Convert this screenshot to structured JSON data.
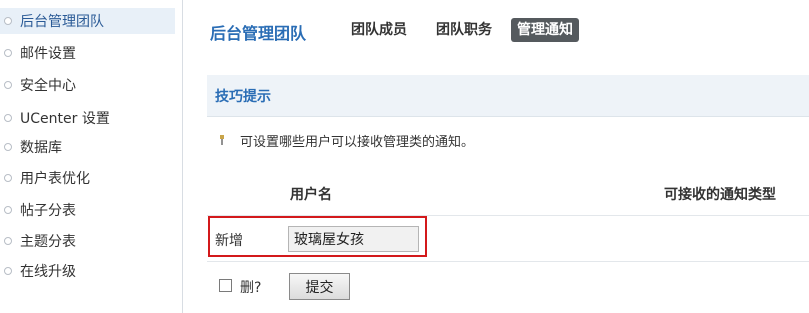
{
  "sidebar": {
    "items": [
      {
        "label": "后台管理团队",
        "active": true
      },
      {
        "label": "邮件设置"
      },
      {
        "label": "安全中心"
      },
      {
        "label": "UCenter 设置"
      },
      {
        "label": "数据库"
      },
      {
        "label": "用户表优化"
      },
      {
        "label": "帖子分表"
      },
      {
        "label": "主题分表"
      },
      {
        "label": "在线升级"
      }
    ]
  },
  "header": {
    "title": "后台管理团队",
    "tabs": [
      {
        "label": "团队成员"
      },
      {
        "label": "团队职务"
      },
      {
        "label": "管理通知",
        "active": true
      }
    ]
  },
  "tips": {
    "title": "技巧提示",
    "text": "可设置哪些用户可以接收管理类的通知。"
  },
  "table": {
    "columns": [
      "用户名",
      "可接收的通知类型"
    ],
    "new_row": {
      "label": "新增",
      "value": "玻璃屋女孩"
    }
  },
  "footer": {
    "delete_label": "删?",
    "submit_label": "提交"
  },
  "colors": {
    "accent": "#2a6db5",
    "active_tab_bg": "#555a5e",
    "highlight_border": "#d3191b",
    "tips_bg": "#eef3f8"
  }
}
